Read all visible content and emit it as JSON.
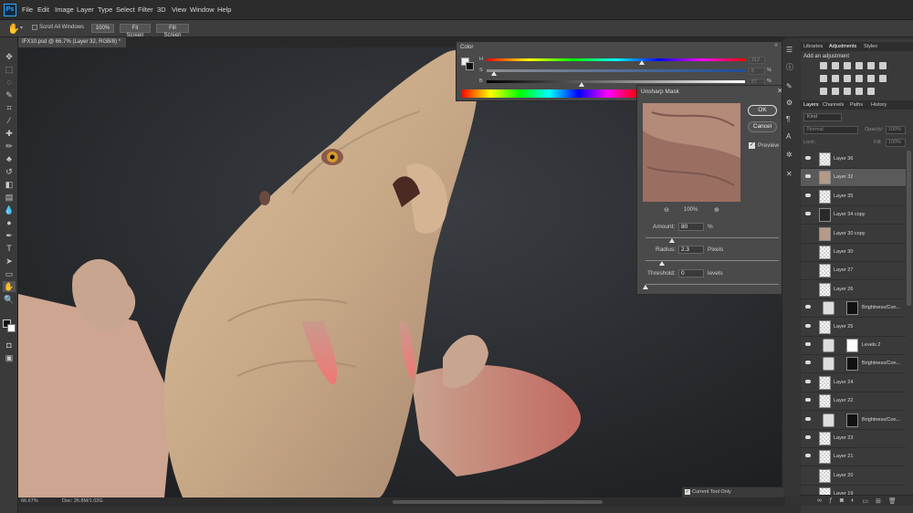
{
  "app": {
    "logo": "Ps"
  },
  "menu": [
    "File",
    "Edit",
    "Image",
    "Layer",
    "Type",
    "Select",
    "Filter",
    "3D",
    "View",
    "Window",
    "Help"
  ],
  "options": {
    "scroll_all": "Scroll All Windows",
    "zoom": "100%",
    "fit": "Fit Screen",
    "fill": "Fill Screen"
  },
  "document": {
    "tab": "IFX10.psd @ 66.7% (Layer 32, RGB/8) *",
    "zoom": "66.67%",
    "doc_size": "Doc: 26.8M/1.02G"
  },
  "color_panel": {
    "title": "Color",
    "h": "H",
    "s": "S",
    "b": "B",
    "h_value": "212",
    "s_value": "5",
    "b_value": "57",
    "pct": "%"
  },
  "dialog": {
    "title": "Unsharp Mask",
    "ok": "OK",
    "cancel": "Cancel",
    "preview": "Preview",
    "zoom": "100%",
    "amount_label": "Amount:",
    "amount_value": "80",
    "amount_unit": "%",
    "radius_label": "Radius:",
    "radius_value": "2.3",
    "radius_unit": "Pixels",
    "threshold_label": "Threshold:",
    "threshold_value": "0",
    "threshold_unit": "levels",
    "amount_level": 0.2,
    "radius_level": 0.12,
    "threshold_level": 0.0
  },
  "right_tabs": [
    "Libraries",
    "Adjustments",
    "Styles"
  ],
  "adjustments": {
    "title": "Add an adjustment"
  },
  "layers_tabs": [
    "Layers",
    "Channels",
    "Paths",
    "History"
  ],
  "layers_controls": {
    "kind": "Kind",
    "blend": "Normal",
    "opacity_label": "Opacity:",
    "opacity": "100%",
    "lock_label": "Lock:",
    "fill_label": "Fill:",
    "fill": "100%"
  },
  "layers": [
    {
      "name": "Layer 36",
      "visible": true
    },
    {
      "name": "Layer 32",
      "visible": true,
      "selected": true
    },
    {
      "name": "Layer 35",
      "visible": true
    },
    {
      "name": "Layer 34 copy",
      "visible": true
    },
    {
      "name": "Layer 30 copy",
      "visible": false
    },
    {
      "name": "Layer 30",
      "visible": false
    },
    {
      "name": "Layer 27",
      "visible": false
    },
    {
      "name": "Layer 26",
      "visible": false
    },
    {
      "name": "Brightness/Con...",
      "visible": true
    },
    {
      "name": "Layer 25",
      "visible": true
    },
    {
      "name": "Levels 2",
      "visible": true
    },
    {
      "name": "Brightness/Con...",
      "visible": true
    },
    {
      "name": "Layer 24",
      "visible": true
    },
    {
      "name": "Layer 22",
      "visible": true
    },
    {
      "name": "Brightness/Con...",
      "visible": true
    },
    {
      "name": "Layer 23",
      "visible": true
    },
    {
      "name": "Layer 21",
      "visible": true
    },
    {
      "name": "Layer 20",
      "visible": false
    },
    {
      "name": "Layer 19",
      "visible": false
    }
  ],
  "footer": {
    "current_tool_only": "Current Tool Only"
  },
  "colors": {
    "accent": "#31a8ff",
    "chrome": "#3a3a3a",
    "canvas_bg": "#25272a",
    "creature": "#cdb08e",
    "tongue": "#e07a78"
  }
}
